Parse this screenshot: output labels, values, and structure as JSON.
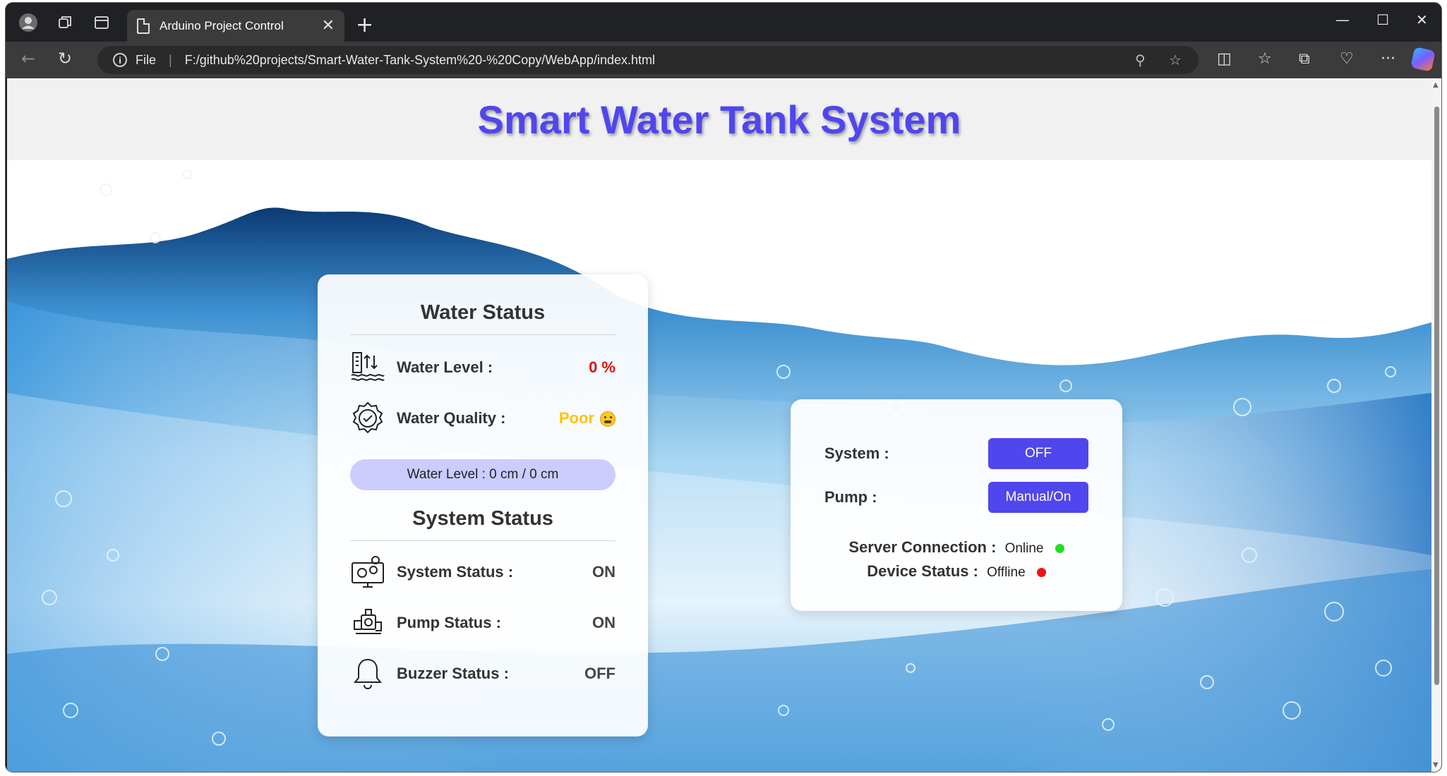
{
  "browser": {
    "tab_title": "Arduino Project Control",
    "address_label": "File",
    "url": "F:/github%20projects/Smart-Water-Tank-System%20-%20Copy/WebApp/index.html"
  },
  "page": {
    "title": "Smart Water Tank System"
  },
  "water_status": {
    "heading": "Water Status",
    "level_label": "Water Level :",
    "level_value": "0 %",
    "quality_label": "Water Quality :",
    "quality_value": "Poor",
    "level_detail": "Water Level : 0 cm / 0 cm"
  },
  "system_status": {
    "heading": "System Status",
    "system_label": "System Status :",
    "system_value": "ON",
    "pump_label": "Pump Status :",
    "pump_value": "ON",
    "buzzer_label": "Buzzer Status :",
    "buzzer_value": "OFF"
  },
  "controls": {
    "system_label": "System :",
    "system_button": "OFF",
    "pump_label": "Pump :",
    "pump_button": "Manual/On",
    "server_label": "Server Connection :",
    "server_value": "Online",
    "server_color": "#22dd22",
    "device_label": "Device Status :",
    "device_value": "Offline",
    "device_color": "#ee1111"
  },
  "colors": {
    "accent": "#5046ee",
    "level_value": "#e01010",
    "quality_value": "#ffc400"
  }
}
